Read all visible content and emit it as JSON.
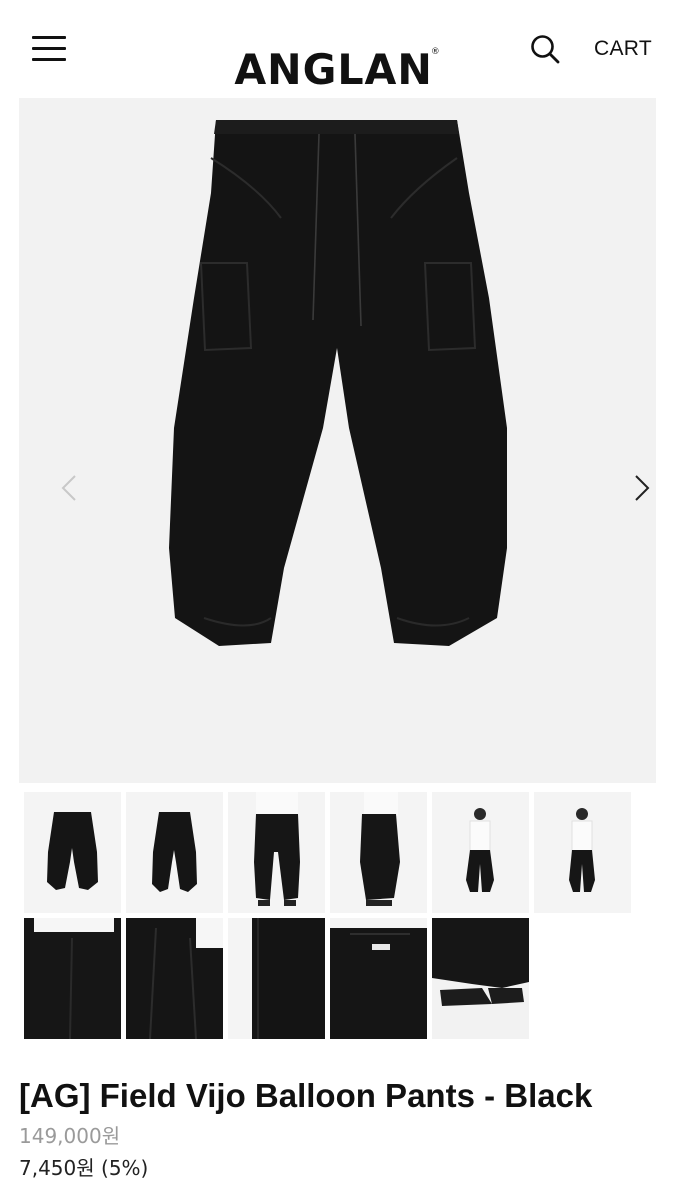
{
  "header": {
    "logo": "ANGLAN",
    "logo_mark": "®",
    "menu_icon": "hamburger-menu-icon",
    "search_icon": "search-icon",
    "cart_label": "CART"
  },
  "gallery": {
    "prev_icon": "chevron-left-icon",
    "next_icon": "chevron-right-icon",
    "hero_background": "#f2f2f2",
    "product_color": "#141414",
    "thumbnails": [
      {
        "kind": "pants-front"
      },
      {
        "kind": "pants-back"
      },
      {
        "kind": "model-front-crop"
      },
      {
        "kind": "model-side-crop"
      },
      {
        "kind": "model-full-front"
      },
      {
        "kind": "model-full-back"
      },
      {
        "kind": "detail-hip"
      },
      {
        "kind": "detail-pleat"
      },
      {
        "kind": "detail-fabric"
      },
      {
        "kind": "detail-waist-label"
      },
      {
        "kind": "detail-hem-shoes"
      }
    ]
  },
  "product": {
    "title": "[AG] Field Vijo Balloon Pants - Black",
    "original_price": "149,000원",
    "sale_price": "7,450원 (5%)"
  }
}
